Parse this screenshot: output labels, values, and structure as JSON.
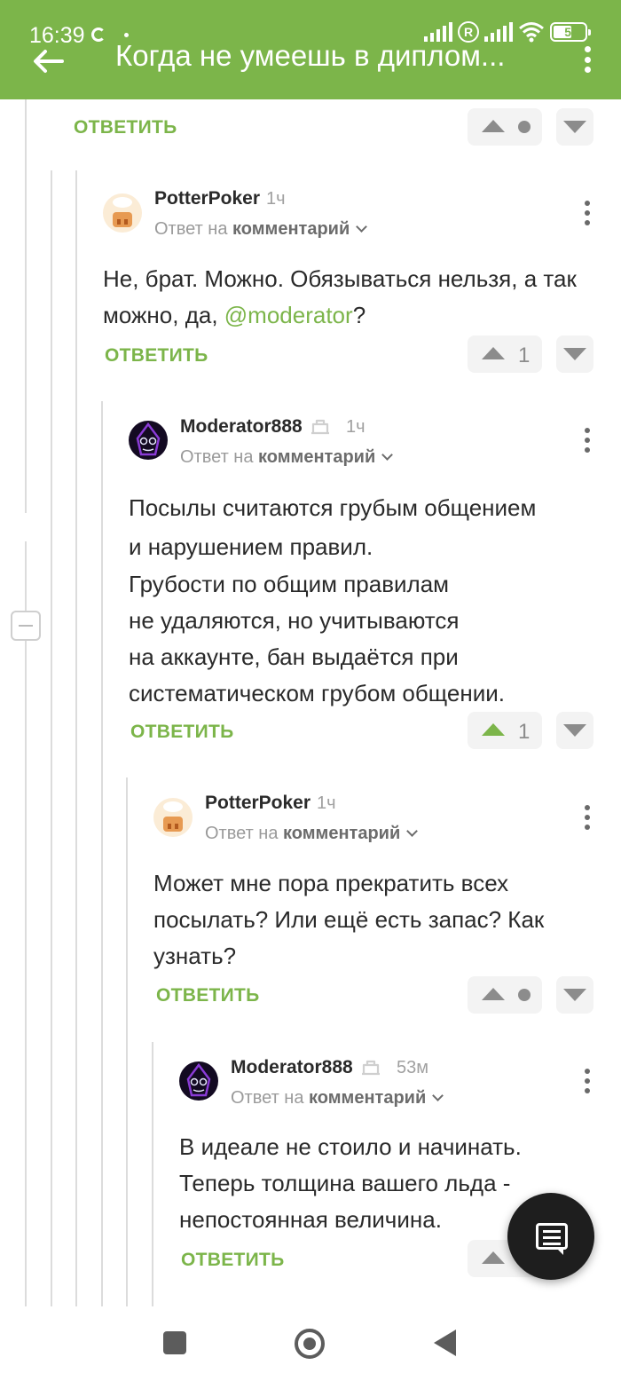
{
  "status_bar": {
    "time": "16:39",
    "battery": "54"
  },
  "header": {
    "title": "Когда не умеешь в диплом..."
  },
  "colors": {
    "accent": "#7cb54a",
    "header_bg": "#7cb54a",
    "text": "#2a2a2a",
    "muted": "#9a9a9a"
  },
  "first_item": {
    "reply_label": "ОТВЕТИТЬ"
  },
  "comments": [
    {
      "author": "PotterPoker",
      "time": "1ч",
      "reply_prefix": "Ответ на",
      "reply_target": "комментарий",
      "text_parts": [
        "Не, брат. Можно. Обязываться нельзя, а так можно, да, ",
        "@moderator",
        "?"
      ],
      "reply_label": "ОТВЕТИТЬ",
      "rating": "1"
    },
    {
      "author": "Moderator888",
      "time": "1ч",
      "reply_prefix": "Ответ на",
      "reply_target": "комментарий",
      "lines": [
        "Посылы считаются грубым общением",
        "и нарушением правил.",
        "Грубости по общим правилам",
        "не удаляются, но учитываются",
        "на аккаунте, бан выдаётся при",
        "систематическом грубом общении."
      ],
      "reply_label": "ОТВЕТИТЬ",
      "rating": "1"
    },
    {
      "author": "PotterPoker",
      "time": "1ч",
      "reply_prefix": "Ответ на",
      "reply_target": "комментарий",
      "lines": [
        "Может мне пора прекратить всех",
        "посылать? Или ещё есть запас? Как",
        "узнать?"
      ],
      "reply_label": "ОТВЕТИТЬ"
    },
    {
      "author": "Moderator888",
      "time": "53м",
      "reply_prefix": "Ответ на",
      "reply_target": "комментарий",
      "lines": [
        "В идеале не стоило и начинать.",
        "Теперь толщина вашего льда -",
        "непостоянная величина."
      ],
      "reply_label": "ОТВЕТИТЬ"
    }
  ],
  "icons": {
    "back": "arrow-left-icon",
    "menu": "kebab-menu-icon",
    "fab": "comment-icon",
    "moderator_badge": "moderator-badge-icon"
  }
}
